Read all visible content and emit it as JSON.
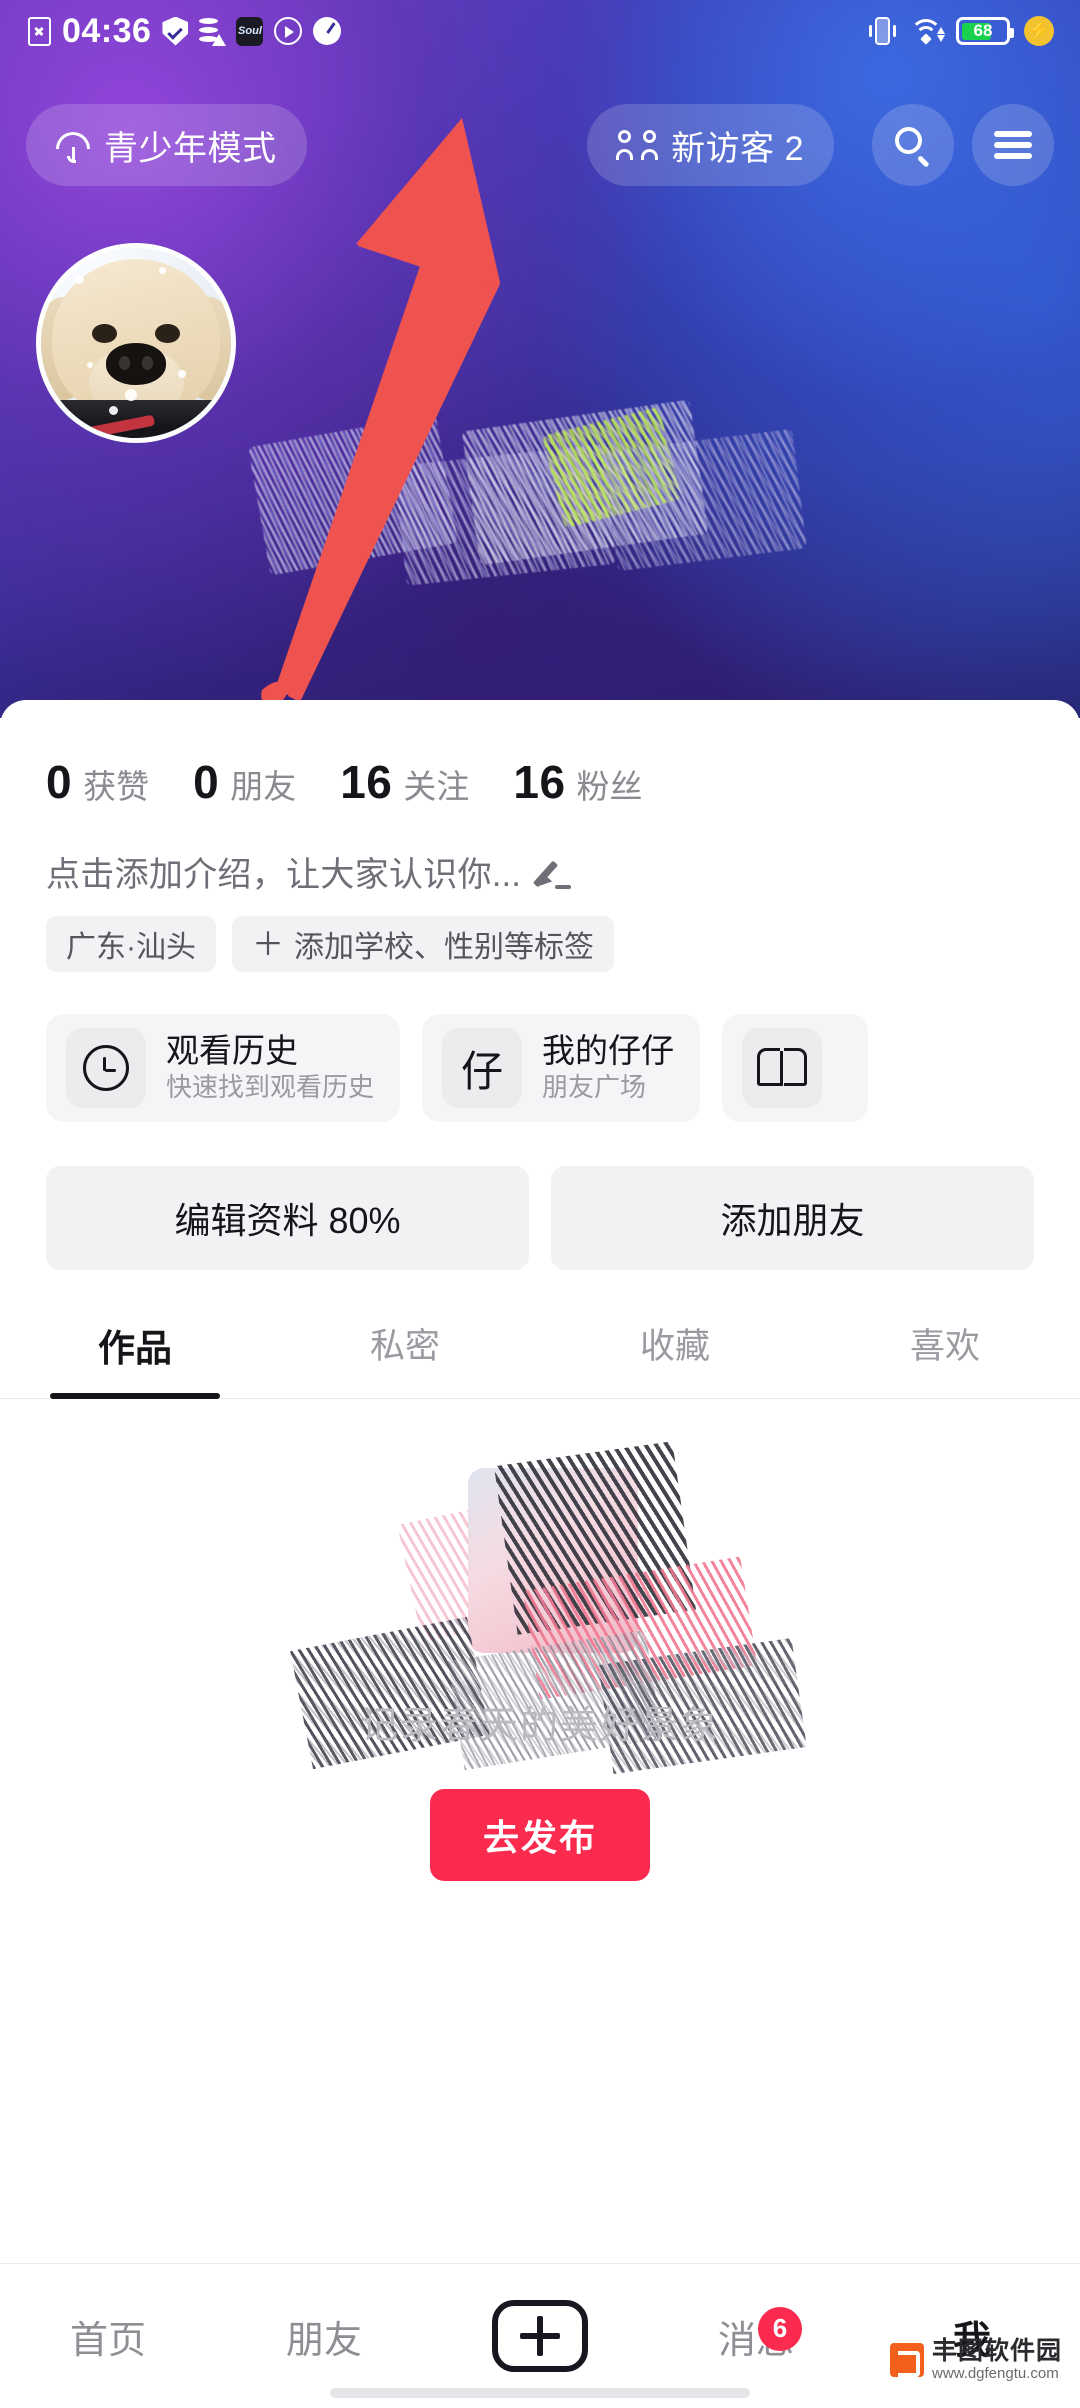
{
  "status_bar": {
    "time": "04:36",
    "battery_level": "68",
    "left_icons": [
      "sim-no-card-icon",
      "shield-check-icon",
      "database-warning-icon",
      "soul-app-icon",
      "play-circle-icon",
      "speedometer-icon"
    ],
    "right_icons": [
      "vibrate-icon",
      "wifi-icon",
      "battery-icon",
      "charging-bolt-icon"
    ]
  },
  "top_bar": {
    "teen_mode_label": "青少年模式",
    "teen_mode_icon": "umbrella-icon",
    "visitors_label": "新访客 2",
    "visitors_icon": "two-people-icon",
    "search_icon": "search-icon",
    "menu_icon": "hamburger-menu-icon"
  },
  "annotation": {
    "arrow_color": "#ef5350",
    "points_to": "新访客 2"
  },
  "profile": {
    "avatar_alt": "golden-retriever-puppy-avatar",
    "stats": [
      {
        "value": "0",
        "label": "获赞"
      },
      {
        "value": "0",
        "label": "朋友"
      },
      {
        "value": "16",
        "label": "关注"
      },
      {
        "value": "16",
        "label": "粉丝"
      }
    ],
    "bio_placeholder": "点击添加介绍，让大家认识你...",
    "bio_edit_icon": "pencil-edit-icon",
    "tags": [
      {
        "text": "广东·汕头",
        "has_plus": false
      },
      {
        "text": "添加学校、性别等标签",
        "has_plus": true,
        "plus": "＋"
      }
    ]
  },
  "shortcut_cards": [
    {
      "icon": "clock-icon",
      "title": "观看历史",
      "subtitle": "快速找到观看历史"
    },
    {
      "icon": "zai-character-icon",
      "icon_text": "仔",
      "title": "我的仔仔",
      "subtitle": "朋友广场"
    },
    {
      "icon": "open-book-icon",
      "title": "",
      "subtitle": ""
    }
  ],
  "actions": [
    {
      "label": "编辑资料 80%"
    },
    {
      "label": "添加朋友"
    }
  ],
  "tabs": [
    {
      "label": "作品",
      "active": true
    },
    {
      "label": "私密",
      "active": false
    },
    {
      "label": "收藏",
      "active": false
    },
    {
      "label": "喜欢",
      "active": false
    }
  ],
  "empty_state": {
    "illustration": "brush-stroke-illustration",
    "text": "记录春天的美好景象",
    "publish_label": "去发布",
    "publish_color": "#fa2b4e"
  },
  "bottom_nav": [
    {
      "label": "首页",
      "active": false,
      "badge": ""
    },
    {
      "label": "朋友",
      "active": false,
      "badge": ""
    },
    {
      "label": "",
      "active": false,
      "badge": "",
      "icon": "plus-create-icon"
    },
    {
      "label": "消息",
      "active": false,
      "badge": "6"
    },
    {
      "label": "我",
      "active": true,
      "badge": ""
    }
  ],
  "watermark": {
    "name": "丰图软件园",
    "url": "www.dgfengtu.com"
  }
}
